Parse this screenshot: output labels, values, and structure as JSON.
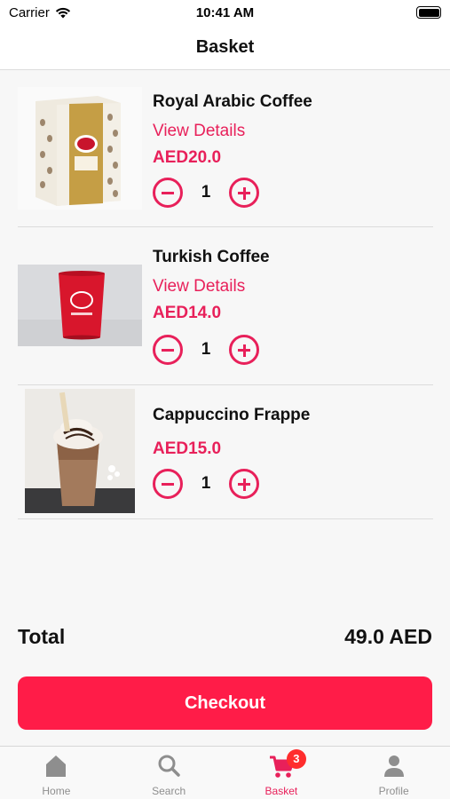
{
  "status_bar": {
    "carrier": "Carrier",
    "time": "10:41 AM"
  },
  "nav": {
    "title": "Basket"
  },
  "items": [
    {
      "name": "Royal Arabic Coffee",
      "link": "View Details",
      "price": "AED20.0",
      "qty": "1"
    },
    {
      "name": "Turkish Coffee",
      "link": "View Details",
      "price": "AED14.0",
      "qty": "1"
    },
    {
      "name": "Cappuccino Frappe",
      "price": "AED15.0",
      "qty": "1"
    }
  ],
  "total": {
    "label": "Total",
    "value": "49.0 AED"
  },
  "checkout": {
    "label": "Checkout"
  },
  "tabs": [
    {
      "label": "Home",
      "icon": "home-icon"
    },
    {
      "label": "Search",
      "icon": "search-icon"
    },
    {
      "label": "Basket",
      "icon": "cart-icon",
      "badge": "3",
      "active": true
    },
    {
      "label": "Profile",
      "icon": "person-icon"
    }
  ],
  "colors": {
    "accent": "#e8205a",
    "checkout": "#ff1c48",
    "badge": "#ff2d2d"
  }
}
